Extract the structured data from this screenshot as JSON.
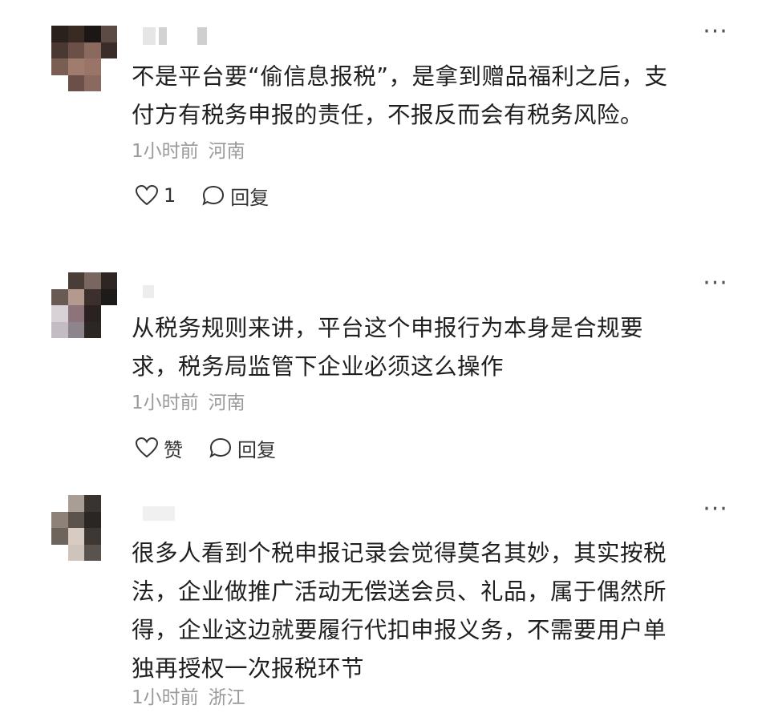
{
  "colors": {
    "text": "#1f1f1f",
    "meta": "#9a9a9a",
    "icon": "#333333"
  },
  "comments": [
    {
      "content_lines": [
        "不是平台要“偷信息报税”，是拿到赠品福利之后，支",
        "付方有税务申报的责任，不报反而会有税务风险。"
      ],
      "time": "1小时前",
      "location": "河南",
      "like_label": "1",
      "reply_label": "回复",
      "more_label": "···"
    },
    {
      "content_lines": [
        "从税务规则来讲，平台这个申报行为本身是合规要",
        "求，税务局监管下企业必须这么操作"
      ],
      "time": "1小时前",
      "location": "河南",
      "like_label": "赞",
      "reply_label": "回复",
      "more_label": "···"
    },
    {
      "content_lines": [
        "很多人看到个税申报记录会觉得莫名其妙，其实按税",
        "法，企业做推广活动无偿送会员、礼品，属于偶然所",
        "得，企业这边就要履行代扣申报义务，不需要用户单",
        "独再授权一次报税环节"
      ],
      "time": "1小时前",
      "location": "浙江",
      "more_label": "···"
    }
  ]
}
